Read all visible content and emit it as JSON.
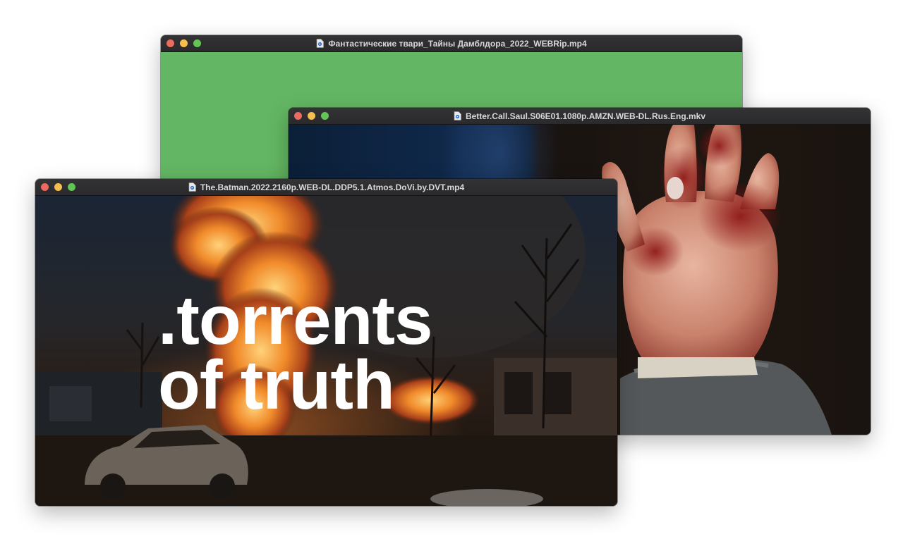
{
  "windows": [
    {
      "title": "Фантастические твари_Тайны Дамблдора_2022_WEBRip.mp4",
      "content_color": "#63b663"
    },
    {
      "title": "Better.Call.Saul.S06E01.1080p.AMZN.WEB-DL.Rus.Eng.mkv"
    },
    {
      "title": "The.Batman.2022.2160p.WEB-DL.DDP5.1.Atmos.DoVi.by.DVT.mp4"
    }
  ],
  "headline": {
    "line1": ".torrents",
    "line2": "of truth"
  },
  "traffic_light_colors": {
    "close": "#ed6a5e",
    "minimize": "#f5bf4f",
    "maximize": "#61c554"
  },
  "icons": {
    "file": "document-file-icon"
  }
}
